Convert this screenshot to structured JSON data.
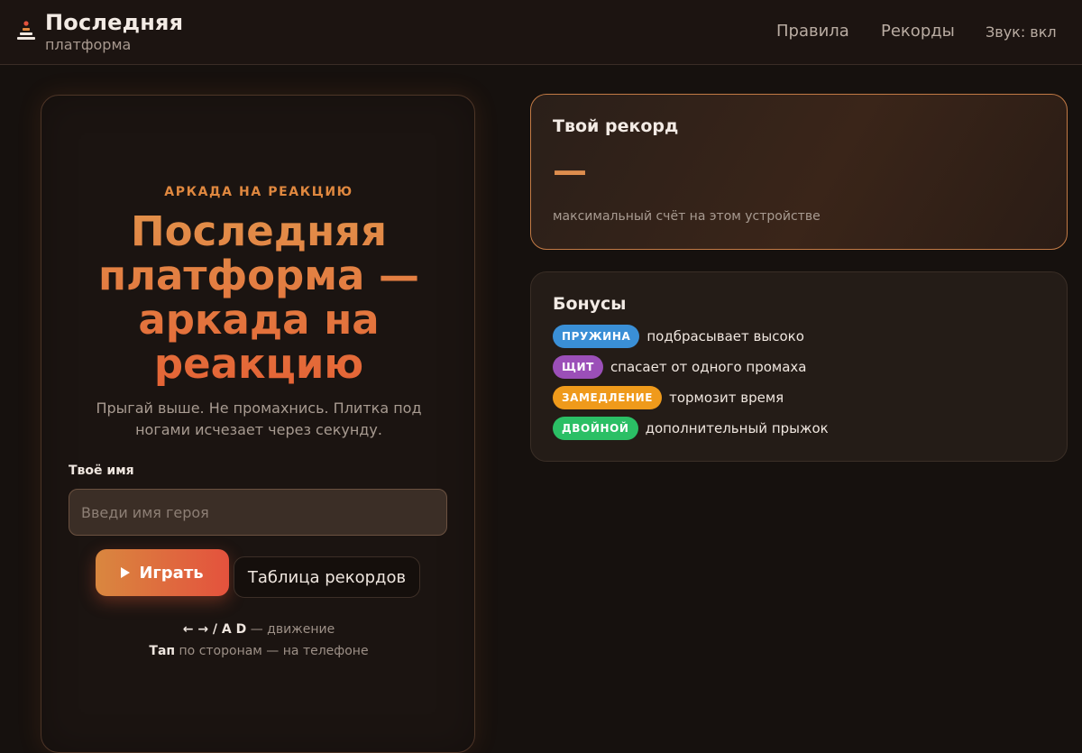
{
  "header": {
    "brand_title": "Последняя",
    "brand_subtitle": "платформа",
    "logo_icon": "stack-tower-icon",
    "nav": {
      "rules": "Правила",
      "records": "Рекорды",
      "sound": "Звук: вкл"
    }
  },
  "hero": {
    "kicker": "АРКАДА НА РЕАКЦИЮ",
    "title": "Последняя платформа — аркада на реакцию",
    "description": "Прыгай выше. Не промахнись. Плитка под ногами исчезает через секунду.",
    "name_label": "Твоё имя",
    "name_placeholder": "Введи имя героя",
    "name_value": "",
    "play_label": "Играть",
    "play_icon": "play-icon",
    "records_label": "Таблица рекордов",
    "hint_keys": "← → / A D",
    "hint_keys_text": " — движение",
    "hint_tap": "Тап",
    "hint_tap_text": " по сторонам — на телефоне"
  },
  "record": {
    "title": "Твой рекорд",
    "value": "—",
    "caption": "максимальный счёт на этом устройстве"
  },
  "bonuses": {
    "title": "Бонусы",
    "items": [
      {
        "badge": "ПРУЖИНА",
        "text": "подбрасывает высоко",
        "color": "#3a8fd6"
      },
      {
        "badge": "ЩИТ",
        "text": "спасает от одного промаха",
        "color": "#9b4fb8"
      },
      {
        "badge": "ЗАМЕДЛЕНИЕ",
        "text": "тормозит время",
        "color": "#ef9a1b"
      },
      {
        "badge": "ДВОЙНОЙ",
        "text": "дополнительный прыжок",
        "color": "#2bbf65"
      }
    ]
  },
  "colors": {
    "accent": "#e0883f",
    "accent_red": "#e4523d",
    "background": "#16110e"
  }
}
